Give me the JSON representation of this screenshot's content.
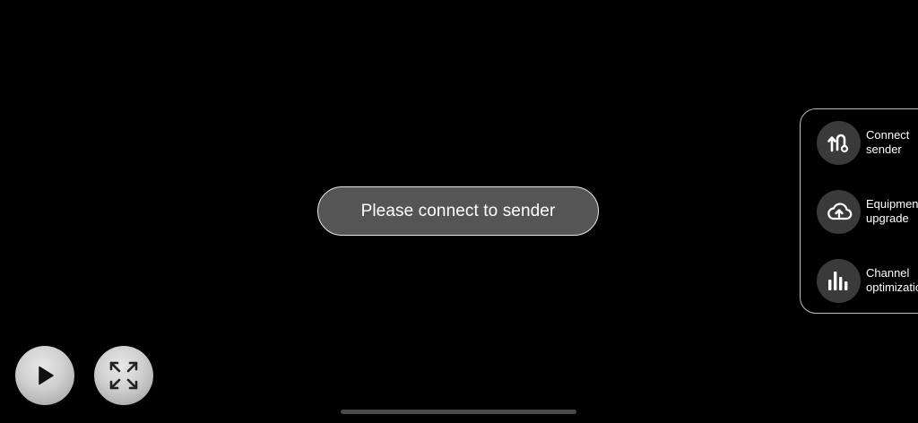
{
  "toast": {
    "message": "Please connect to sender"
  },
  "side_panel": {
    "items": [
      {
        "label": "Connect\nsender",
        "icon": "connect-route-icon"
      },
      {
        "label": "Equipment\nupgrade",
        "icon": "cloud-upload-icon"
      },
      {
        "label": "Channel\noptimization",
        "icon": "bar-chart-icon"
      }
    ]
  },
  "controls": {
    "play_icon": "play-icon",
    "fullscreen_icon": "expand-arrows-icon"
  },
  "colors": {
    "background": "#000000",
    "toast_background": "#555555",
    "icon_circle": "#3a3a3a",
    "button_gray": "#cfcfcf"
  }
}
